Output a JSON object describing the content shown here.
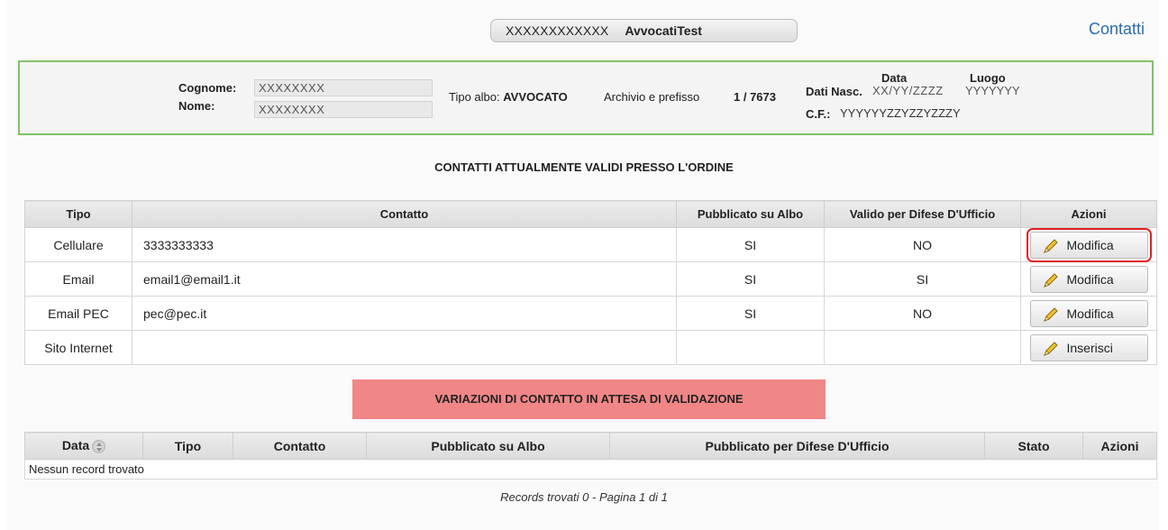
{
  "header": {
    "code": "XXXXXXXXXXXX",
    "username": "AvvocatiTest",
    "contacts_link": "Contatti"
  },
  "person": {
    "cognome_label": "Cognome:",
    "cognome_value": "XXXXXXXX",
    "nome_label": "Nome:",
    "nome_value": "XXXXXXXX",
    "tipo_albo_label": "Tipo albo:",
    "tipo_albo_value": "AVVOCATO",
    "archivio_label": "Archivio e prefisso",
    "archivio_value": "1 / 7673",
    "data_label": "Data",
    "luogo_label": "Luogo",
    "dati_nasc_label": "Dati Nasc.",
    "data_value": "XX/YY/ZZZZ",
    "luogo_value": "YYYYYYY",
    "cf_label": "C.F.:",
    "cf_value": "YYYYYYZZYZZYZZZY"
  },
  "contacts_section": {
    "title": "CONTATTI ATTUALMENTE VALIDI PRESSO L'ORDINE",
    "headers": [
      "Tipo",
      "Contatto",
      "Pubblicato su Albo",
      "Valido per Difese D'Ufficio",
      "Azioni"
    ],
    "rows": [
      {
        "tipo": "Cellulare",
        "contatto": "3333333333",
        "pubblicato": "SI",
        "valido": "NO",
        "action": "Modifica"
      },
      {
        "tipo": "Email",
        "contatto": "email1@email1.it",
        "pubblicato": "SI",
        "valido": "SI",
        "action": "Modifica"
      },
      {
        "tipo": "Email PEC",
        "contatto": "pec@pec.it",
        "pubblicato": "SI",
        "valido": "NO",
        "action": "Modifica"
      },
      {
        "tipo": "Sito Internet",
        "contatto": "",
        "pubblicato": "",
        "valido": "",
        "action": "Inserisci"
      }
    ]
  },
  "variations_section": {
    "title": "VARIAZIONI DI CONTATTO IN ATTESA DI VALIDAZIONE",
    "headers": [
      "Data",
      "Tipo",
      "Contatto",
      "Pubblicato su Albo",
      "Pubblicato per Difese D'Ufficio",
      "Stato",
      "Azioni"
    ],
    "empty_message": "Nessun record trovato"
  },
  "footer": {
    "records_text": "Records trovati 0 - Pagina 1 di 1"
  },
  "colors": {
    "accent_link": "#2a6db3",
    "person_border": "#7dc466",
    "banner": "#f08686",
    "highlight": "#e02020"
  }
}
